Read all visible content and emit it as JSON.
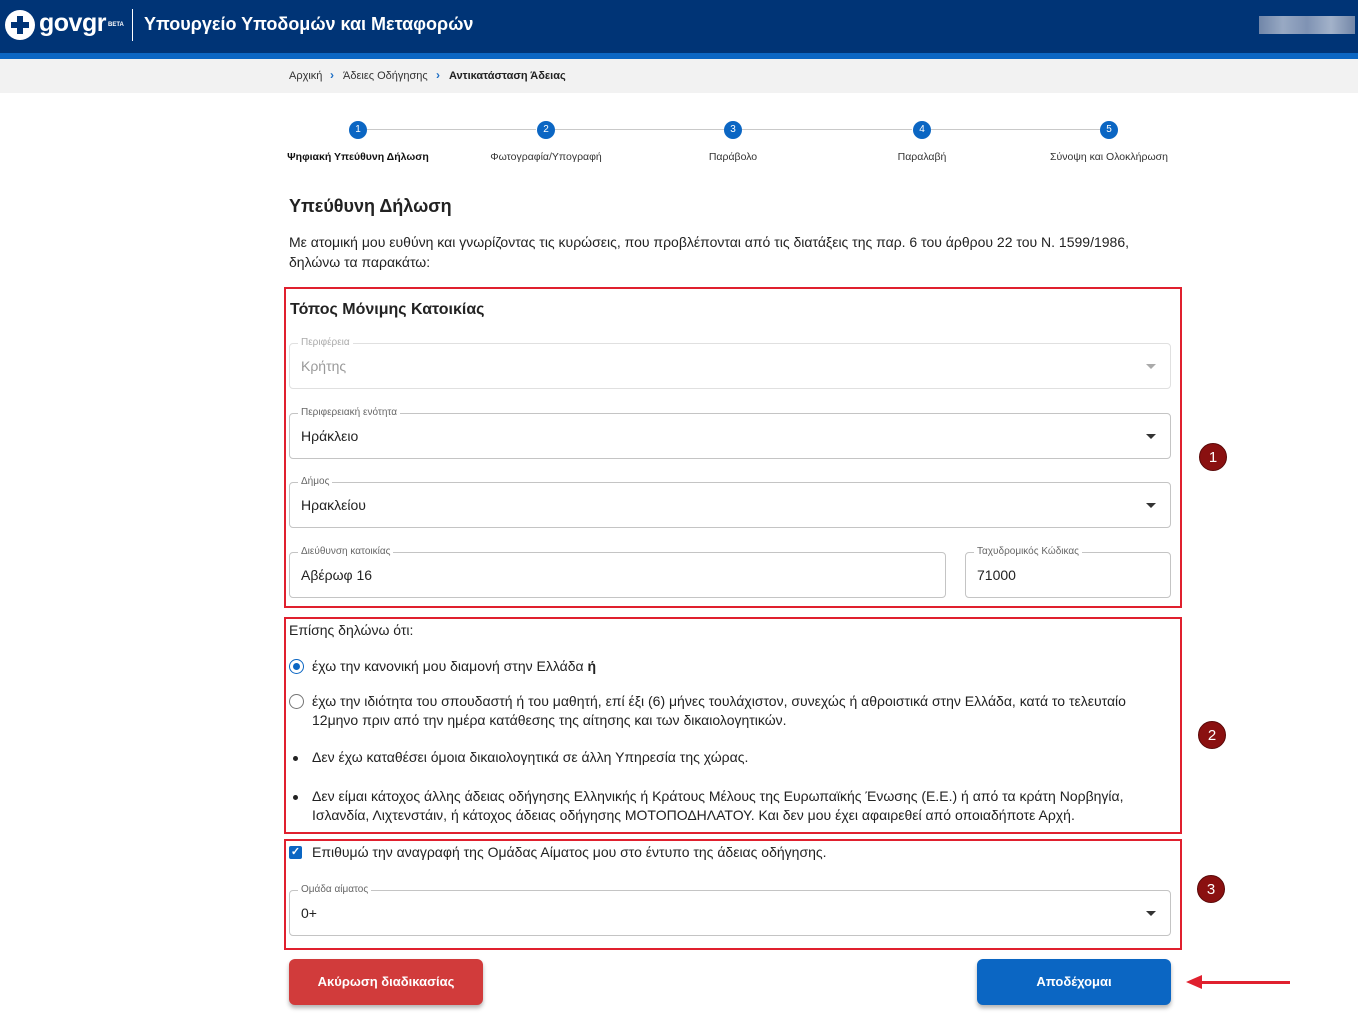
{
  "header": {
    "logo_text": "govgr",
    "beta_label": "BETA",
    "ministry_title": "Υπουργείο Υποδομών και Μεταφορών"
  },
  "breadcrumb": {
    "items": [
      "Αρχική",
      "Άδειες Οδήγησης",
      "Αντικατάσταση Άδειας"
    ]
  },
  "stepper": {
    "steps": [
      {
        "number": "1",
        "label": "Ψηφιακή Υπεύθυνη Δήλωση"
      },
      {
        "number": "2",
        "label": "Φωτογραφία/Υπογραφή"
      },
      {
        "number": "3",
        "label": "Παράβολο"
      },
      {
        "number": "4",
        "label": "Παραλαβή"
      },
      {
        "number": "5",
        "label": "Σύνοψη και Ολοκλήρωση"
      }
    ]
  },
  "page": {
    "title": "Υπεύθυνη Δήλωση",
    "intro": "Με ατομική μου ευθύνη και γνωρίζοντας τις κυρώσεις, που προβλέπονται από τις διατάξεις της παρ. 6 του άρθρου 22 του Ν. 1599/1986, δηλώνω τα παρακάτω:"
  },
  "residence": {
    "title": "Τόπος Μόνιμης Κατοικίας",
    "region": {
      "label": "Περιφέρεια",
      "value": "Κρήτης"
    },
    "regional_unit": {
      "label": "Περιφερειακή ενότητα",
      "value": "Ηράκλειο"
    },
    "municipality": {
      "label": "Δήμος",
      "value": "Ηρακλείου"
    },
    "address": {
      "label": "Διεύθυνση κατοικίας",
      "value": "Αβέρωφ 16"
    },
    "postal_code": {
      "label": "Ταχυδρομικός Κώδικας",
      "value": "71000"
    }
  },
  "declarations": {
    "lead": "Επίσης δηλώνω ότι:",
    "option1": "έχω την κανονική μου διαμονή στην Ελλάδα",
    "option1_suffix": "ή",
    "option2": "έχω την ιδιότητα του σπουδαστή ή του μαθητή, επί έξι (6) μήνες τουλάχιστον, συνεχώς ή αθροιστικά στην Ελλάδα, κατά το τελευταίο 12μηνο πριν από την ημέρα κατάθεσης της αίτησης και των δικαιολογητικών.",
    "bullet1": "Δεν έχω καταθέσει όμοια δικαιολογητικά σε άλλη Υπηρεσία της χώρας.",
    "bullet2": "Δεν είμαι κάτοχος άλλης άδειας οδήγησης Ελληνικής ή Κράτους Μέλους της Ευρωπαϊκής Ένωσης (Ε.Ε.) ή από τα κράτη Νορβηγία, Ισλανδία, Λιχτενστάιν, ή κάτοχος άδειας οδήγησης ΜΟΤΟΠΟΔΗΛΑΤΟΥ. Και δεν μου έχει αφαιρεθεί από οποιαδήποτε Αρχή."
  },
  "blood": {
    "checkbox_label": "Επιθυμώ την αναγραφή της Ομάδας Αίματος μου στο έντυπο της άδειας οδήγησης.",
    "checked": true,
    "field_label": "Ομάδα αίματος",
    "value": "0+"
  },
  "annotations": [
    "1",
    "2",
    "3"
  ],
  "actions": {
    "cancel": "Ακύρωση διαδικασίας",
    "accept": "Αποδέχομαι"
  },
  "colors": {
    "header": "#003476",
    "accent": "#0b66c3",
    "cancel": "#d13b3b",
    "annotation": "#e0202e"
  }
}
